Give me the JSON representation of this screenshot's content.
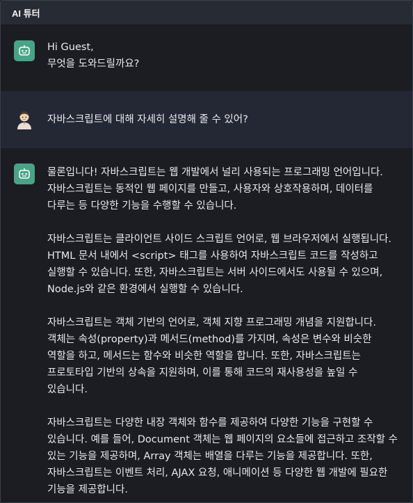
{
  "header": {
    "title": "AI 튜터"
  },
  "messages": [
    {
      "role": "assistant",
      "avatar_icon": "robot-icon",
      "lines": [
        "Hi Guest,",
        "무엇을 도와드릴까요?"
      ]
    },
    {
      "role": "user",
      "avatar_icon": "user-avatar-icon",
      "lines": [
        "자바스크립트에 대해 자세히 설명해 줄 수 있어?"
      ]
    },
    {
      "role": "assistant",
      "avatar_icon": "robot-icon",
      "paragraphs": [
        [
          "물론입니다! 자바스크립트는 웹 개발에서 널리 사용되는 프로그래밍 언어입니다.",
          "자바스크립트는 동적인 웹 페이지를 만들고, 사용자와 상호작용하며, 데이터를",
          "다루는 등 다양한 기능을 수행할 수 있습니다."
        ],
        [
          "자바스크립트는 클라이언트 사이드 스크립트 언어로, 웹 브라우저에서 실행됩니다.",
          "HTML 문서 내에서 <script> 태그를 사용하여 자바스크립트 코드를 작성하고",
          "실행할 수 있습니다. 또한, 자바스크립트는 서버 사이드에서도 사용될 수 있으며,",
          "Node.js와 같은 환경에서 실행할 수 있습니다."
        ],
        [
          "자바스크립트는 객체 기반의 언어로, 객체 지향 프로그래밍 개념을 지원합니다.",
          "객체는 속성(property)과 메서드(method)를 가지며, 속성은 변수와 비슷한",
          "역할을 하고, 메서드는 함수와 비슷한 역할을 합니다. 또한, 자바스크립트는",
          "프로토타입 기반의 상속을 지원하며, 이를 통해 코드의 재사용성을 높일 수",
          "있습니다."
        ],
        [
          "자바스크립트는 다양한 내장 객체와 함수를 제공하여 다양한 기능을 구현할 수",
          "있습니다. 예를 들어, Document 객체는 웹 페이지의 요소들에 접근하고 조작할 수",
          "있는 기능을 제공하며, Array 객체는 배열을 다루는 기능을 제공합니다. 또한,",
          "자바스크립트는 이벤트 처리, AJAX 요청, 애니메이션 등 다양한 웹 개발에 필요한",
          "기능을 제공합니다."
        ]
      ]
    }
  ],
  "colors": {
    "background": "#1a1c22",
    "header_bg": "#272b34",
    "user_msg_bg": "#242834",
    "bot_avatar": "#4aa386"
  }
}
